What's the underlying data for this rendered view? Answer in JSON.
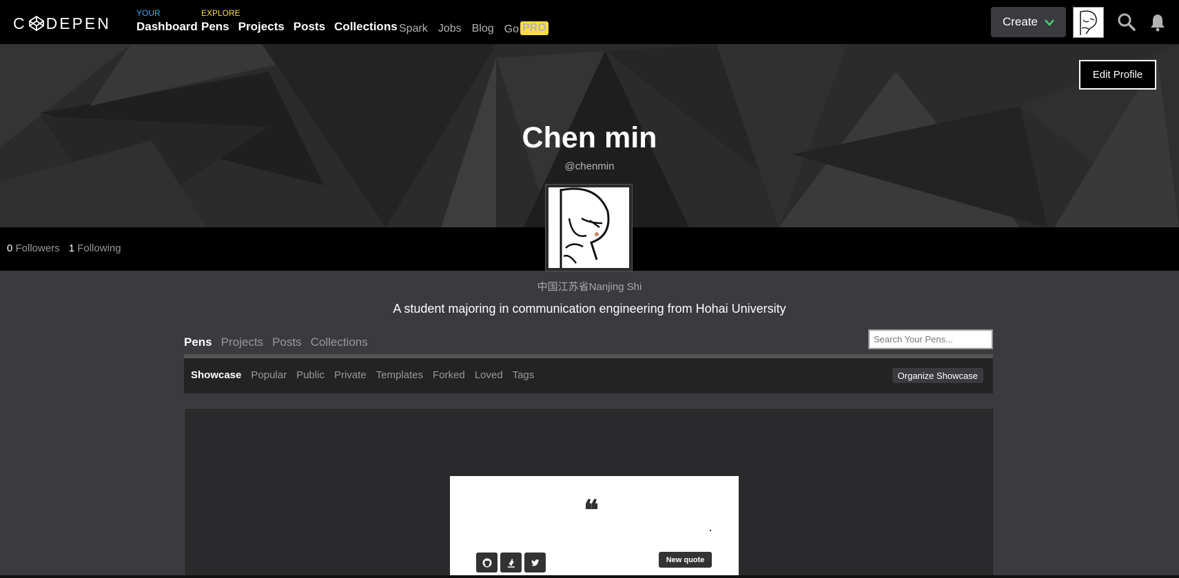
{
  "nav": {
    "logo_text": "CODEPEN",
    "your_label": "YOUR",
    "dashboard": "Dashboard",
    "explore_label": "EXPLORE",
    "explore_links": [
      "Pens",
      "Projects",
      "Posts",
      "Collections"
    ],
    "minor_links": [
      "Spark",
      "Jobs",
      "Blog",
      "Go"
    ],
    "pro_badge": "PRO",
    "create": "Create"
  },
  "profile": {
    "edit_button": "Edit Profile",
    "name": "Chen min",
    "handle": "@chenmin",
    "followers_count": "0",
    "followers_label": "Followers",
    "following_count": "1",
    "following_label": "Following",
    "location": "中国江苏省Nanjing Shi",
    "bio": "A student majoring in communication engineering from Hohai University"
  },
  "tabs": {
    "items": [
      "Pens",
      "Projects",
      "Posts",
      "Collections"
    ],
    "active": "Pens",
    "search_placeholder": "Search Your Pens..."
  },
  "subtabs": {
    "items": [
      "Showcase",
      "Popular",
      "Public",
      "Private",
      "Templates",
      "Forked",
      "Loved",
      "Tags"
    ],
    "active": "Showcase",
    "organize": "Organize Showcase"
  },
  "showcase_preview": {
    "quote_glyph": "❝",
    "new_quote": "New quote",
    "social_icons": [
      "github-icon",
      "tumblr-icon",
      "twitter-icon"
    ]
  },
  "colors": {
    "your_tag": "#47a5ff",
    "explore_tag": "#ffdd40",
    "create_chevron": "#47cf73",
    "page_bg": "#3a3a3f"
  }
}
